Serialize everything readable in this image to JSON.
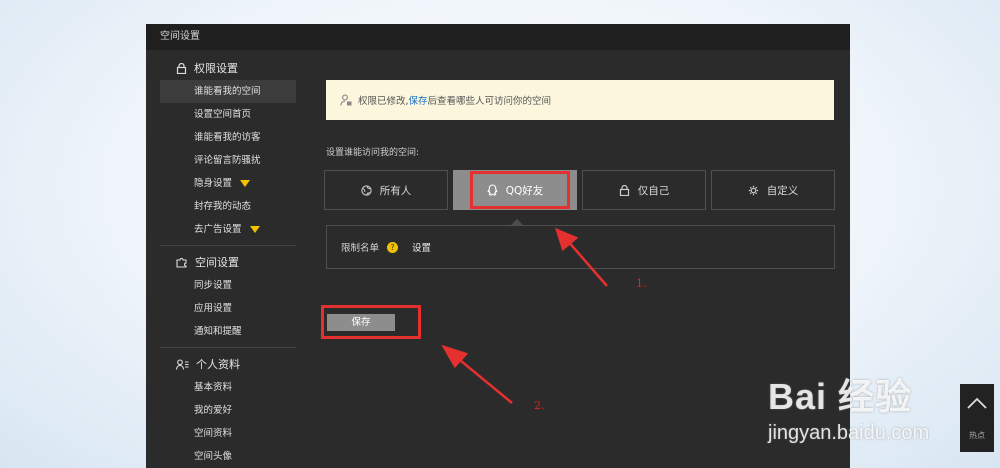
{
  "window": {
    "title": "空间设置"
  },
  "sidebar": {
    "sections": [
      {
        "title": "权限设置",
        "icon": "lock-icon",
        "items": [
          {
            "label": "谁能看我的空间",
            "active": true
          },
          {
            "label": "设置空间首页"
          },
          {
            "label": "谁能看我的访客"
          },
          {
            "label": "评论留言防骚扰"
          },
          {
            "label": "隐身设置",
            "vip": true
          },
          {
            "label": "封存我的动态"
          },
          {
            "label": "去广告设置",
            "vip": true
          }
        ]
      },
      {
        "title": "空间设置",
        "icon": "puzzle-icon",
        "items": [
          {
            "label": "同步设置"
          },
          {
            "label": "应用设置"
          },
          {
            "label": "通知和提醒"
          }
        ]
      },
      {
        "title": "个人资料",
        "icon": "profile-icon",
        "items": [
          {
            "label": "基本资料"
          },
          {
            "label": "我的爱好"
          },
          {
            "label": "空间资料"
          },
          {
            "label": "空间头像"
          }
        ]
      }
    ]
  },
  "notice": {
    "prefix": "权限已修改,",
    "link": "保存",
    "suffix": "后查看哪些人可访问你的空间"
  },
  "access": {
    "label": "设置谁能访问我的空间:",
    "options": [
      {
        "label": "所有人",
        "icon": "globe-icon"
      },
      {
        "label": "QQ好友",
        "icon": "qq-penguin-icon",
        "selected": true
      },
      {
        "label": "仅自己",
        "icon": "lock-icon"
      },
      {
        "label": "自定义",
        "icon": "gear-icon"
      }
    ]
  },
  "restriction": {
    "label": "限制名单",
    "help": "?",
    "action": "设置"
  },
  "save_button": "保存",
  "annotations": {
    "step1": "1.",
    "step2": "2."
  },
  "back_to_top": {
    "label": "热点"
  },
  "watermark": {
    "brand": "Bai 经验",
    "url": "jingyan.baidu.com"
  },
  "colors": {
    "highlight": "#e53030",
    "vip": "#f2c200",
    "link": "#1a6fc1"
  }
}
